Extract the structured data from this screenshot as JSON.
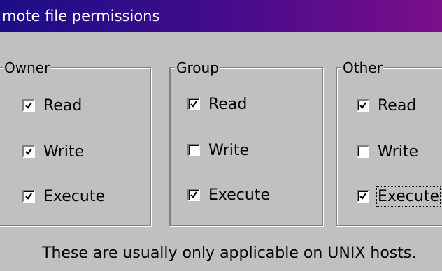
{
  "window": {
    "title": "mote file permissions"
  },
  "groups": [
    {
      "label": "Owner",
      "options": [
        {
          "label": "Read",
          "checked": true
        },
        {
          "label": "Write",
          "checked": true
        },
        {
          "label": "Execute",
          "checked": true
        }
      ]
    },
    {
      "label": "Group",
      "options": [
        {
          "label": "Read",
          "checked": true
        },
        {
          "label": "Write",
          "checked": false
        },
        {
          "label": "Execute",
          "checked": true
        }
      ]
    },
    {
      "label": "Other",
      "options": [
        {
          "label": "Read",
          "checked": true
        },
        {
          "label": "Write",
          "checked": false
        },
        {
          "label": "Execute",
          "checked": true
        }
      ]
    }
  ],
  "note": "These are usually only applicable on UNIX hosts."
}
